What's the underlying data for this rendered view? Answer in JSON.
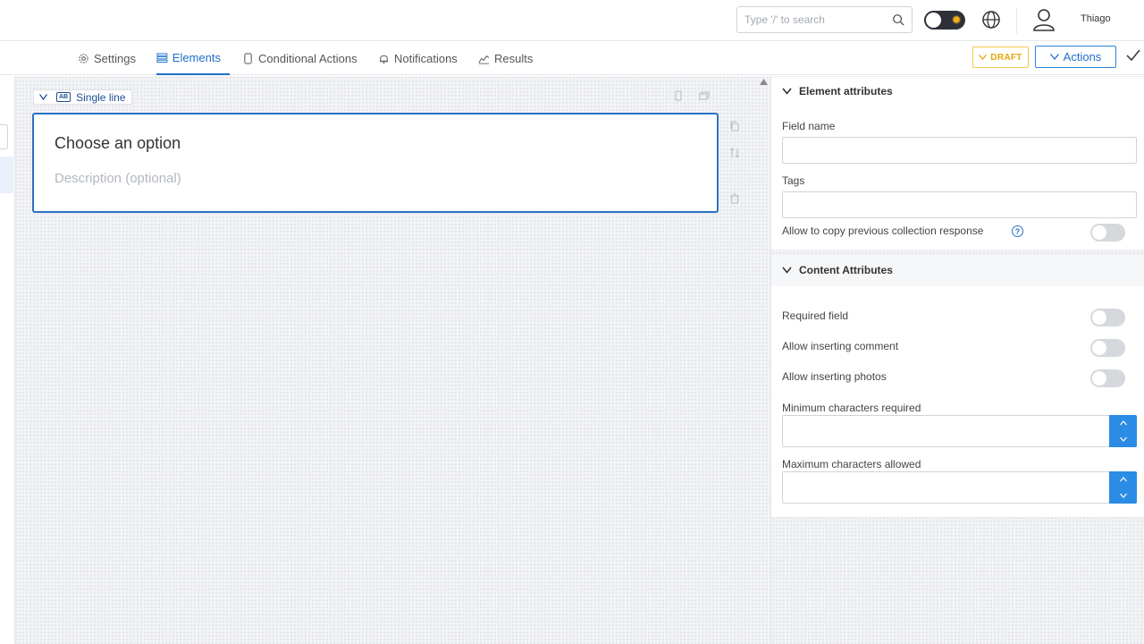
{
  "header": {
    "search_placeholder": "Type '/' to search",
    "username": "Thiago",
    "theme_icon": "sun-icon"
  },
  "tabs": [
    {
      "label": "Settings",
      "icon": "gear-icon"
    },
    {
      "label": "Elements",
      "icon": "list-icon",
      "active": true
    },
    {
      "label": "Conditional Actions",
      "icon": "phone-icon"
    },
    {
      "label": "Notifications",
      "icon": "bell-icon"
    },
    {
      "label": "Results",
      "icon": "chart-icon"
    }
  ],
  "toolbar": {
    "draft_label": "DRAFT",
    "actions_label": "Actions"
  },
  "element": {
    "type_badge": "AB",
    "type_label": "Single line",
    "title": "Choose an option",
    "description_placeholder": "Description (optional)"
  },
  "panel": {
    "element_attributes": {
      "heading": "Element attributes",
      "field_name_label": "Field name",
      "field_name_value": "",
      "tags_label": "Tags",
      "tags_value": "",
      "copy_previous_label": "Allow to copy previous collection response",
      "copy_previous_on": false,
      "help_icon": "?"
    },
    "content_attributes": {
      "heading": "Content Attributes",
      "required_label": "Required field",
      "required_on": false,
      "comment_label": "Allow inserting comment",
      "comment_on": false,
      "photos_label": "Allow inserting photos",
      "photos_on": false,
      "min_chars_label": "Minimum characters required",
      "min_chars_value": "",
      "max_chars_label": "Maximum characters allowed",
      "max_chars_value": ""
    }
  },
  "colors": {
    "accent": "#1e6fc8",
    "draft": "#e5a50a",
    "spinner": "#2b8ce6"
  }
}
